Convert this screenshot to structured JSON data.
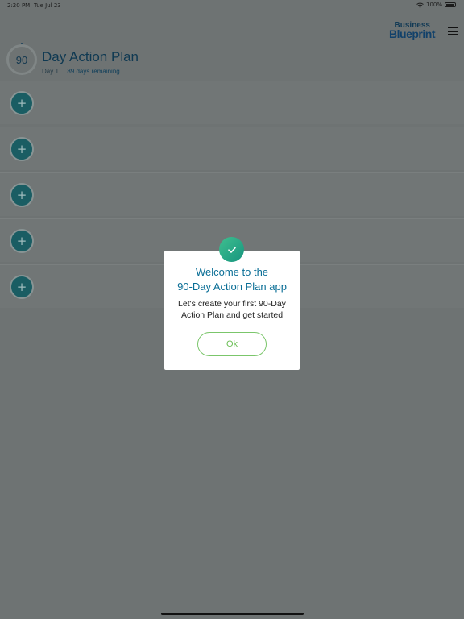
{
  "status_bar": {
    "time": "2:20 PM",
    "date": "Tue Jul 23",
    "battery": "100%"
  },
  "header": {
    "brand_top": "Business",
    "brand_bottom": "Blueprint",
    "day_counter": "90",
    "title": "Day Action Plan",
    "day_label": "Day 1.",
    "remaining_label": "89 days remaining"
  },
  "rows": {
    "add_symbol": "+"
  },
  "dialog": {
    "title": "Welcome to the\n90-Day Action Plan app",
    "body": "Let's create your first 90-Day\nAction Plan and get started",
    "ok_label": "Ok"
  },
  "colors": {
    "overlay": "#6e7373",
    "accent_teal": "#1a5d63",
    "title_blue": "#0a6e96",
    "ok_green": "#6cbf56"
  }
}
